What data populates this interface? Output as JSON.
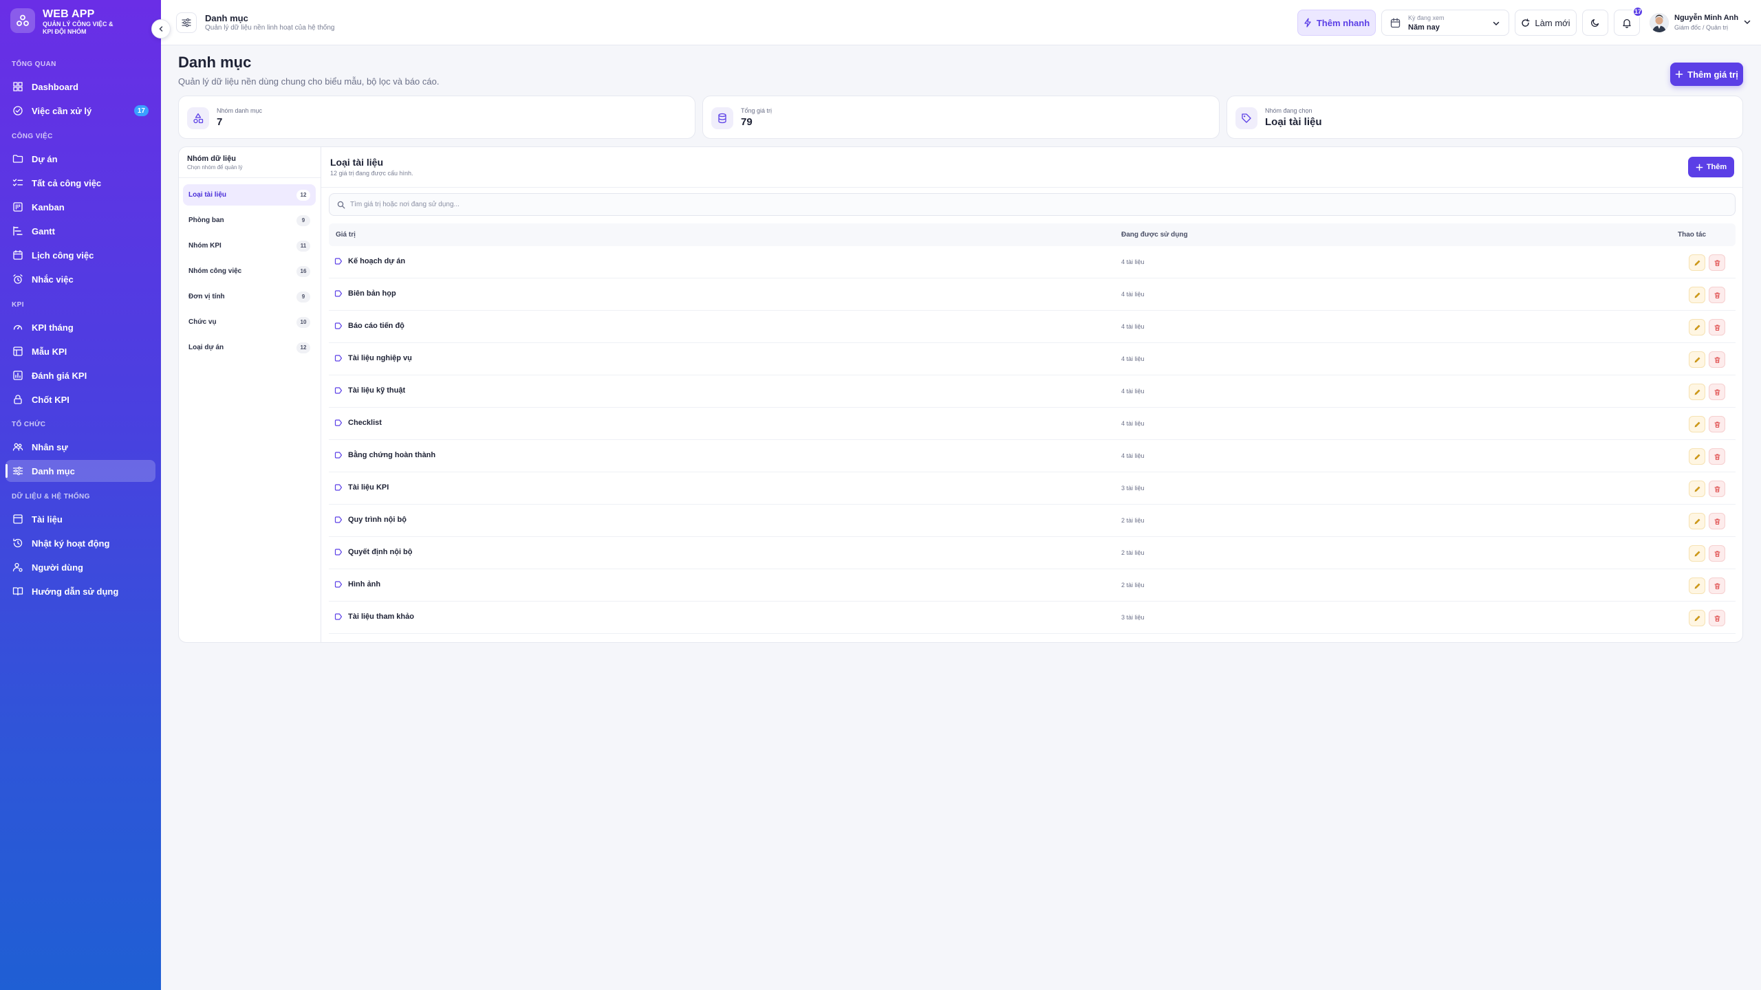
{
  "brand": {
    "title": "WEB APP",
    "subtitle": "QUẢN LÝ CÔNG VIỆC & KPI ĐỘI NHÓM"
  },
  "sidebar": {
    "sections": [
      {
        "label": "TỔNG QUAN",
        "items": [
          {
            "label": "Dashboard",
            "icon": "grid-icon"
          },
          {
            "label": "Việc cần xử lý",
            "icon": "check-circle-icon",
            "badge": "17"
          }
        ]
      },
      {
        "label": "CÔNG VIỆC",
        "items": [
          {
            "label": "Dự án",
            "icon": "folder-icon"
          },
          {
            "label": "Tất cả công việc",
            "icon": "list-check-icon"
          },
          {
            "label": "Kanban",
            "icon": "kanban-icon"
          },
          {
            "label": "Gantt",
            "icon": "gantt-icon"
          },
          {
            "label": "Lịch công việc",
            "icon": "calendar-icon"
          },
          {
            "label": "Nhắc việc",
            "icon": "alarm-icon"
          }
        ]
      },
      {
        "label": "KPI",
        "items": [
          {
            "label": "KPI tháng",
            "icon": "gauge-icon"
          },
          {
            "label": "Mẫu KPI",
            "icon": "template-icon"
          },
          {
            "label": "Đánh giá KPI",
            "icon": "chart-icon"
          },
          {
            "label": "Chốt KPI",
            "icon": "lock-icon"
          }
        ]
      },
      {
        "label": "TỔ CHỨC",
        "items": [
          {
            "label": "Nhân sự",
            "icon": "users-icon"
          },
          {
            "label": "Danh mục",
            "icon": "sliders-icon",
            "active": true
          }
        ]
      },
      {
        "label": "DỮ LIỆU & HỆ THỐNG",
        "items": [
          {
            "label": "Tài liệu",
            "icon": "document-icon"
          },
          {
            "label": "Nhật ký hoạt động",
            "icon": "history-icon"
          },
          {
            "label": "Người dùng",
            "icon": "user-cog-icon"
          },
          {
            "label": "Hướng dẫn sử dụng",
            "icon": "book-icon"
          }
        ]
      }
    ]
  },
  "topbar": {
    "title": "Danh mục",
    "subtitle": "Quản lý dữ liệu nền linh hoạt của hệ thống",
    "quick_add": "Thêm nhanh",
    "period_label": "Kỳ đang xem",
    "period_value": "Năm nay",
    "refresh": "Làm mới",
    "notifications": "17",
    "user_name": "Nguyễn Minh Anh",
    "user_role": "Giám đốc / Quản trị"
  },
  "page": {
    "title": "Danh mục",
    "description": "Quản lý dữ liệu nền dùng chung cho biểu mẫu, bộ lọc và báo cáo.",
    "add_value_button": "Thêm giá trị"
  },
  "stats": [
    {
      "label": "Nhóm danh mục",
      "value": "7",
      "icon": "shapes-icon"
    },
    {
      "label": "Tổng giá trị",
      "value": "79",
      "icon": "database-icon"
    },
    {
      "label": "Nhóm đang chọn",
      "value": "Loại tài liệu",
      "icon": "tag-icon"
    }
  ],
  "groups": {
    "title": "Nhóm dữ liệu",
    "subtitle": "Chọn nhóm để quản lý",
    "items": [
      {
        "label": "Loại tài liệu",
        "count": "12",
        "active": true
      },
      {
        "label": "Phòng ban",
        "count": "9"
      },
      {
        "label": "Nhóm KPI",
        "count": "11"
      },
      {
        "label": "Nhóm công việc",
        "count": "16"
      },
      {
        "label": "Đơn vị tính",
        "count": "9"
      },
      {
        "label": "Chức vụ",
        "count": "10"
      },
      {
        "label": "Loại dự án",
        "count": "12"
      }
    ]
  },
  "content": {
    "title": "Loại tài liệu",
    "subtitle": "12 giá trị đang được cấu hình.",
    "add_button": "Thêm",
    "search_placeholder": "Tìm giá trị hoặc nơi đang sử dụng...",
    "columns": [
      "Giá trị",
      "Đang được sử dụng",
      "Thao tác"
    ],
    "rows": [
      {
        "name": "Kế hoạch dự án",
        "usage": "4 tài liệu"
      },
      {
        "name": "Biên bản họp",
        "usage": "4 tài liệu"
      },
      {
        "name": "Báo cáo tiến độ",
        "usage": "4 tài liệu"
      },
      {
        "name": "Tài liệu nghiệp vụ",
        "usage": "4 tài liệu"
      },
      {
        "name": "Tài liệu kỹ thuật",
        "usage": "4 tài liệu"
      },
      {
        "name": "Checklist",
        "usage": "4 tài liệu"
      },
      {
        "name": "Bằng chứng hoàn thành",
        "usage": "4 tài liệu"
      },
      {
        "name": "Tài liệu KPI",
        "usage": "3 tài liệu"
      },
      {
        "name": "Quy trình nội bộ",
        "usage": "2 tài liệu"
      },
      {
        "name": "Quyết định nội bộ",
        "usage": "2 tài liệu"
      },
      {
        "name": "Hình ảnh",
        "usage": "2 tài liệu"
      },
      {
        "name": "Tài liệu tham khảo",
        "usage": "3 tài liệu"
      }
    ]
  },
  "colors": {
    "accent": "#5b3fe6",
    "sidebar_top": "#6a2ee6",
    "sidebar_bottom": "#1f5fd4",
    "edit": "#d9a21b",
    "delete": "#e05252"
  }
}
